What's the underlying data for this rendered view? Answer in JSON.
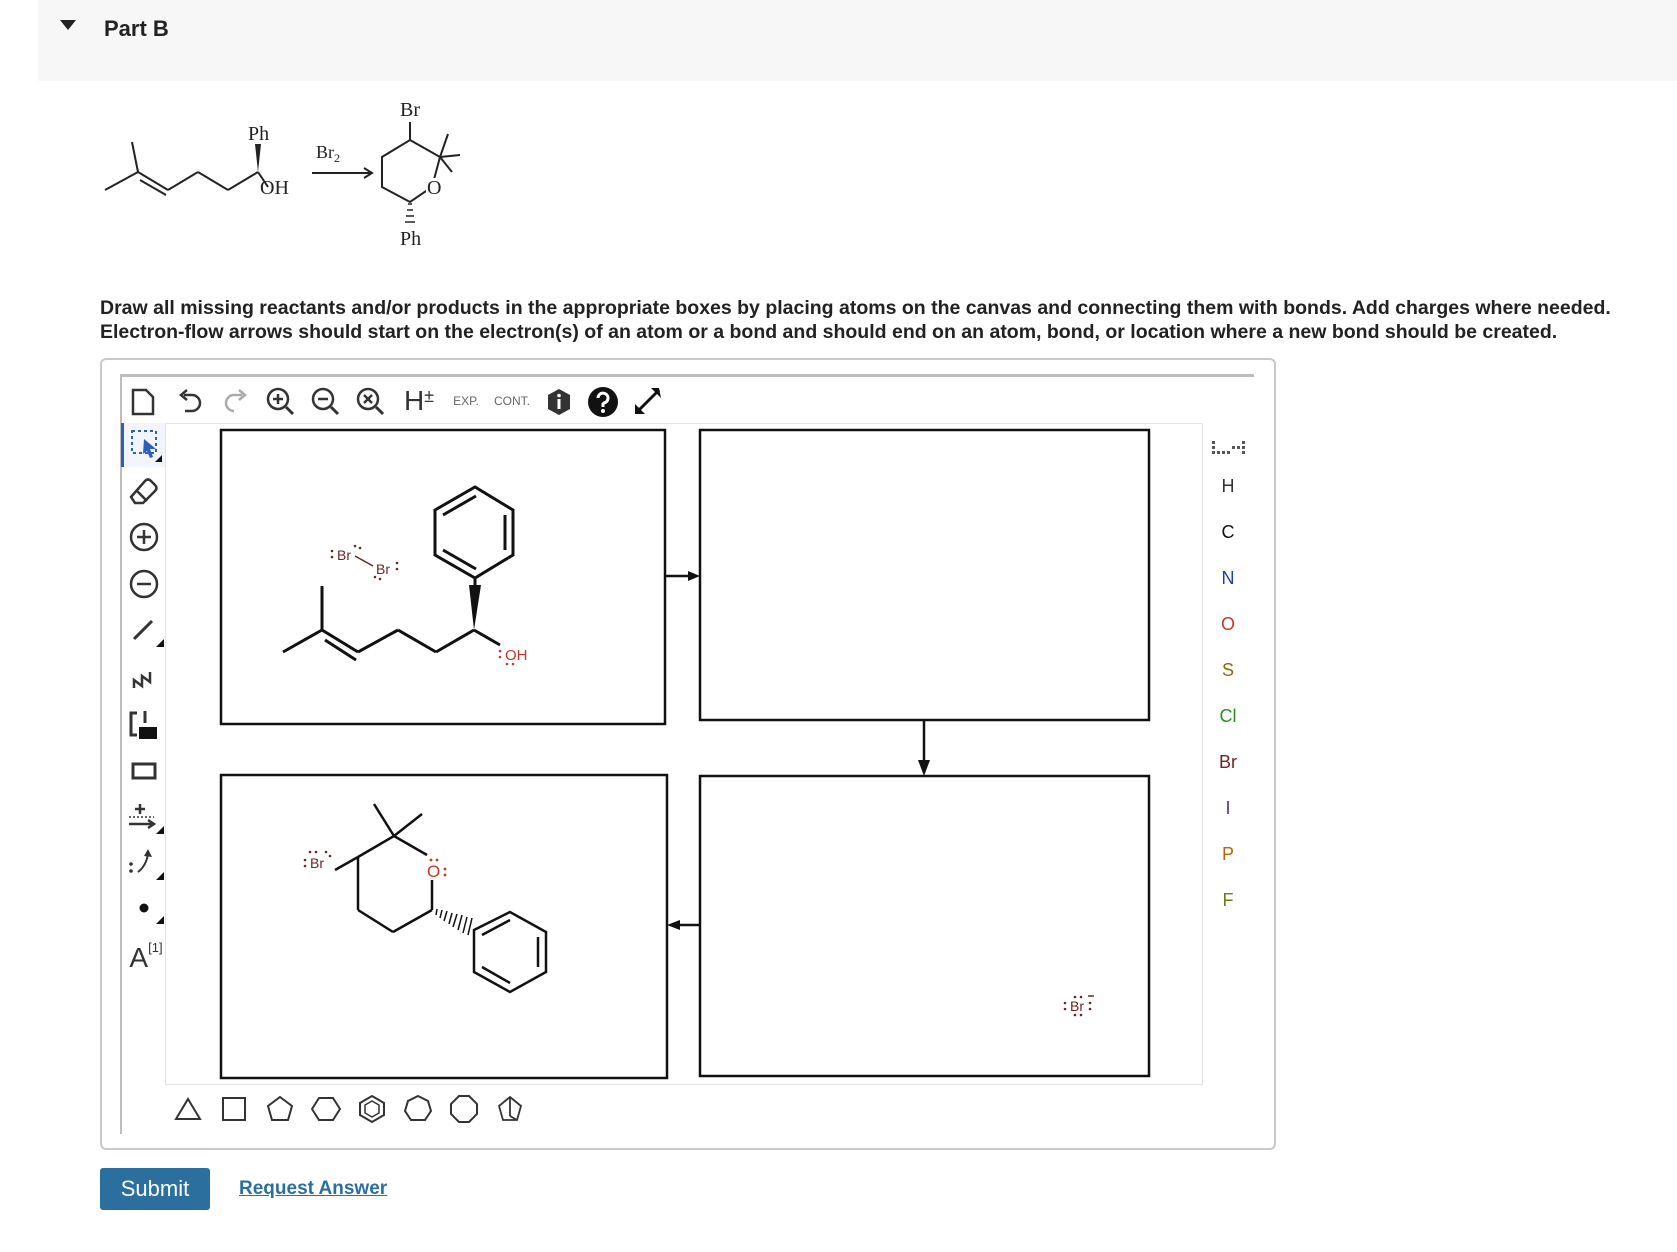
{
  "part": {
    "title": "Part B"
  },
  "scheme": {
    "reactant_substituents": [
      "Ph",
      "OH"
    ],
    "reagent": "Br",
    "reagent_subscript": "2",
    "product_substituents": [
      "Br",
      "O",
      "Ph"
    ]
  },
  "instructions": [
    "Draw all missing reactants and/or products in the appropriate boxes by placing atoms on the canvas and connecting them with bonds. Add charges where needed.",
    "Electron-flow arrows should start on the electron(s) of an atom or a bond and should end on an atom, bond, or location where a new bond should be created."
  ],
  "toolbar": {
    "top": [
      "new-document-icon",
      "undo-icon",
      "redo-icon",
      "zoom-in-icon",
      "zoom-out-icon",
      "zoom-reset-icon",
      "explicit-hydrogens-icon",
      "expand-icon",
      "contract-icon",
      "info-icon",
      "help-icon",
      "fullscreen-icon"
    ],
    "h_label": "H",
    "h_sign": "±",
    "exp_label": "EXP.",
    "cont_label": "CONT.",
    "left": [
      "select-icon",
      "eraser-icon",
      "positive-charge-icon",
      "negative-charge-icon",
      "single-bond-icon",
      "chain-icon",
      "bracket-icon",
      "rectangle-icon",
      "reaction-arrow-icon",
      "electron-flow-arrow-icon",
      "radical-dot-icon",
      "atom-label-icon"
    ],
    "atom_label_text": "A",
    "atom_label_superscript": "[1]",
    "bottom": [
      "triangle-icon",
      "square-icon",
      "pentagon-icon",
      "hexagon-icon",
      "benzene-icon",
      "heptagon-icon",
      "octagon-icon",
      "bicyclic-icon"
    ]
  },
  "elements": [
    {
      "symbol": "H",
      "color": "#333333"
    },
    {
      "symbol": "C",
      "color": "#111111"
    },
    {
      "symbol": "N",
      "color": "#1f3fa8"
    },
    {
      "symbol": "O",
      "color": "#c0392b"
    },
    {
      "symbol": "S",
      "color": "#8a6d00"
    },
    {
      "symbol": "Cl",
      "color": "#2e8b22"
    },
    {
      "symbol": "Br",
      "color": "#6b2525"
    },
    {
      "symbol": "I",
      "color": "#5b2e91"
    },
    {
      "symbol": "P",
      "color": "#b06a00"
    },
    {
      "symbol": "F",
      "color": "#6e7a20"
    }
  ],
  "canvas": {
    "box1": {
      "bromine_label": "Br",
      "oh_label": "OH"
    },
    "box3": {
      "bromide_label": "Br"
    },
    "box4": {
      "bromine_label": "Br",
      "oxygen_label": "O"
    }
  },
  "actions": {
    "submit_label": "Submit",
    "request_answer_label": "Request Answer"
  },
  "colors": {
    "accent": "#2b6f9e",
    "oxygen": "#c0392b",
    "bromine": "#6b2525"
  }
}
